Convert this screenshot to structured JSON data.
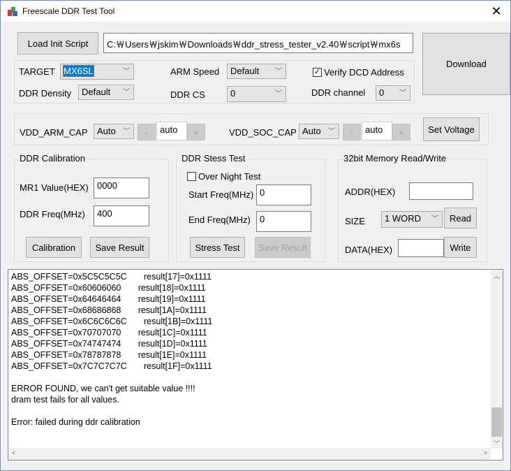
{
  "window": {
    "title": "Freescale DDR Test Tool",
    "close": "✕"
  },
  "top": {
    "load_button": "Load Init Script",
    "script_path": "C:￦Users￦jskim￦Downloads￦ddr_stress_tester_v2.40￦script￦mx6s",
    "download_button": "Download"
  },
  "config": {
    "target_label": "TARGET",
    "target_value": "MX6SL",
    "density_label": "DDR Density",
    "density_value": "Default",
    "arm_speed_label": "ARM Speed",
    "arm_speed_value": "Default",
    "ddr_cs_label": "DDR CS",
    "ddr_cs_value": "0",
    "verify_dcd_label": "Verify DCD Address",
    "verify_dcd_checked": true,
    "ddr_channel_label": "DDR channel",
    "ddr_channel_value": "0"
  },
  "voltage": {
    "arm_cap_label": "VDD_ARM_CAP",
    "arm_cap_value": "Auto",
    "arm_minus": "-",
    "arm_text": "auto",
    "arm_plus": "+",
    "soc_cap_label": "VDD_SOC_CAP",
    "soc_cap_value": "Auto",
    "soc_minus": "-",
    "soc_text": "auto",
    "soc_plus": "+",
    "set_button": "Set Voltage"
  },
  "calibration": {
    "title": "DDR Calibration",
    "mr1_label": "MR1 Value(HEX)",
    "mr1_value": "0000",
    "freq_label": "DDR Freq(MHz)",
    "freq_value": "400",
    "calibration_button": "Calibration",
    "save_button": "Save Result"
  },
  "stress": {
    "title": "DDR Stess Test",
    "overnight_label": "Over Night Test",
    "overnight_checked": false,
    "start_label": "Start Freq(MHz)",
    "start_value": "0",
    "end_label": "End Freq(MHz)",
    "end_value": "0",
    "stress_button": "Stress Test",
    "save_button": "Save Result"
  },
  "memory": {
    "title": "32bit Memory Read/Write",
    "addr_label": "ADDR(HEX)",
    "addr_value": "",
    "size_label": "SIZE",
    "size_value": "1 WORD",
    "read_button": "Read",
    "data_label": "DATA(HEX)",
    "data_value": "",
    "write_button": "Write"
  },
  "log": {
    "lines": [
      "ABS_OFFSET=0x5C5C5C5C       result[17]=0x1111",
      "ABS_OFFSET=0x60606060       result[18]=0x1111",
      "ABS_OFFSET=0x64646464       result[19]=0x1111",
      "ABS_OFFSET=0x68686868       result[1A]=0x1111",
      "ABS_OFFSET=0x6C6C6C6C       result[1B]=0x1111",
      "ABS_OFFSET=0x70707070       result[1C]=0x1111",
      "ABS_OFFSET=0x74747474       result[1D]=0x1111",
      "ABS_OFFSET=0x78787878       result[1E]=0x1111",
      "ABS_OFFSET=0x7C7C7C7C       result[1F]=0x1111",
      "",
      "ERROR FOUND, we can't get suitable value !!!!",
      "dram test fails for all values.",
      "",
      "Error: failed during ddr calibration"
    ]
  }
}
